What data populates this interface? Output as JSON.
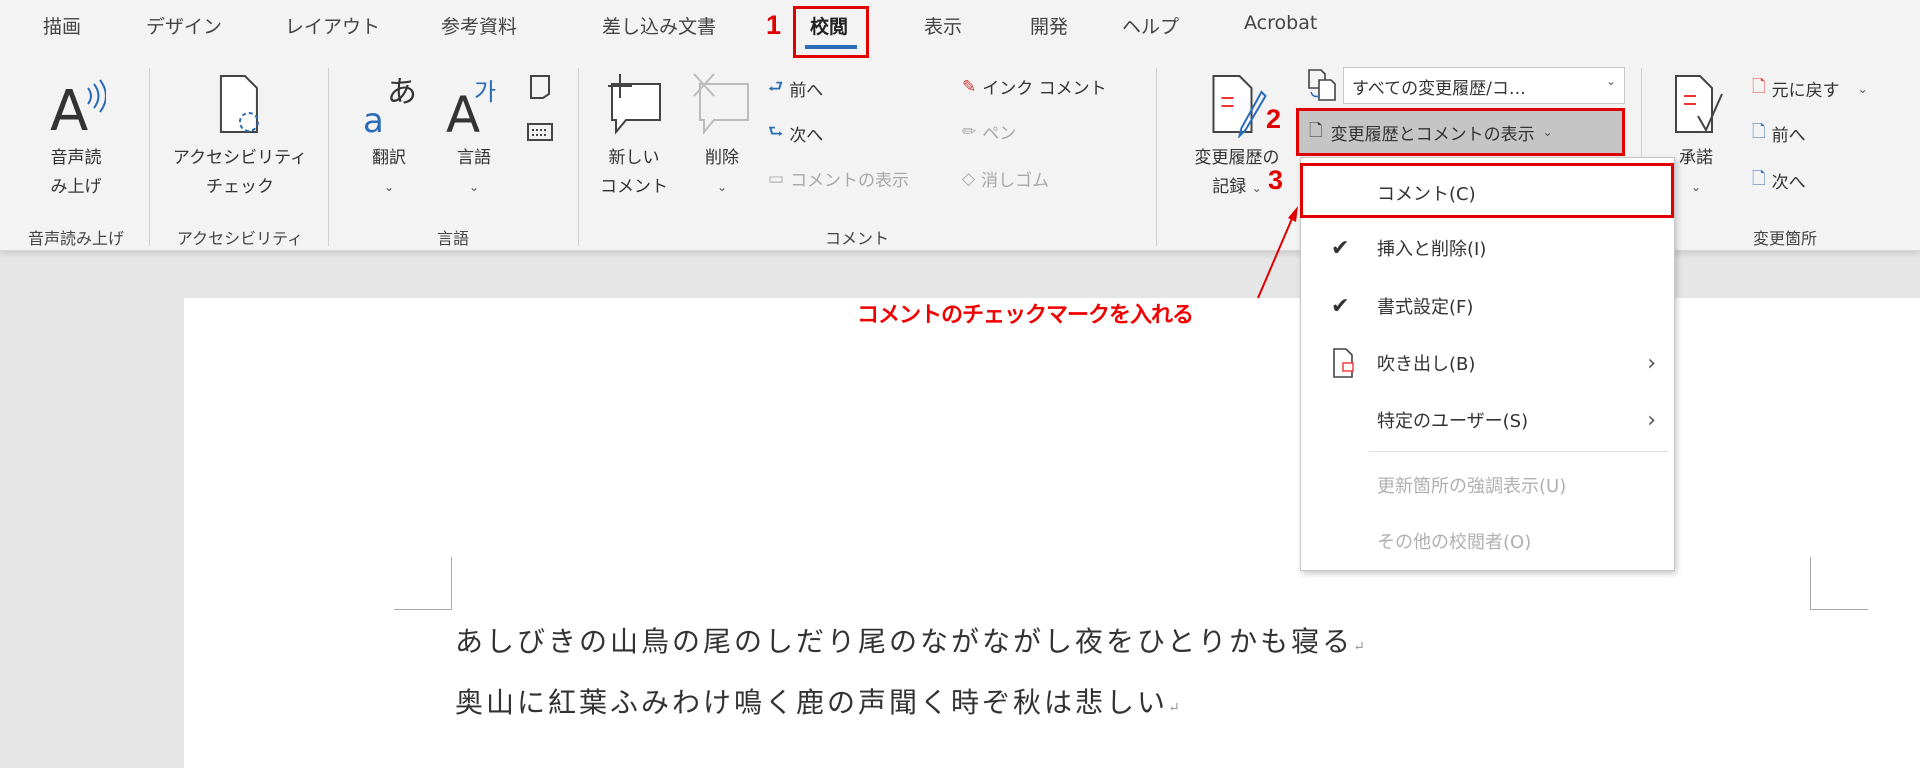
{
  "tabs": [
    "描画",
    "デザイン",
    "レイアウト",
    "参考資料",
    "差し込み文書",
    "校閲",
    "表示",
    "開発",
    "ヘルプ",
    "Acrobat"
  ],
  "active_tab": "校閲",
  "steps": [
    "1",
    "2",
    "3"
  ],
  "ribbon": {
    "speech": {
      "label1": "音声読",
      "label2": "み上げ",
      "group": "音声読み上げ"
    },
    "accessibility": {
      "label1": "アクセシビリティ",
      "label2": "チェック",
      "group": "アクセシビリティ"
    },
    "language": {
      "translate": "翻訳",
      "language": "言語",
      "group": "言語"
    },
    "comments": {
      "new1": "新しい",
      "new2": "コメント",
      "delete": "削除",
      "prev": "前へ",
      "next": "次へ",
      "show": "コメントの表示",
      "ink": "インク コメント",
      "pen": "ペン",
      "eraser": "消しゴム",
      "group": "コメント"
    },
    "tracking": {
      "record1": "変更履歴の",
      "record2": "記録",
      "combo_value": "すべての変更履歴/コ…",
      "show_markup": "変更履歴とコメントの表示"
    },
    "changes": {
      "accept": "承諾",
      "reject": "元に戻す",
      "prev": "前へ",
      "next": "次へ",
      "group": "変更箇所"
    }
  },
  "menu": {
    "items": [
      {
        "label": "コメント(C)",
        "checked": false
      },
      {
        "label": "挿入と削除(I)",
        "checked": true
      },
      {
        "label": "書式設定(F)",
        "checked": true
      },
      {
        "label": "吹き出し(B)",
        "submenu": true
      },
      {
        "label": "特定のユーザー(S)",
        "submenu": true
      },
      {
        "label": "更新箇所の強調表示(U)",
        "disabled": true
      },
      {
        "label": "その他の校閲者(O)",
        "disabled": true
      }
    ]
  },
  "annotation": "コメントのチェックマークを入れる",
  "document": {
    "lines": [
      "あしびきの山鳥の尾のしだり尾のながながし夜をひとりかも寝る",
      "奥山に紅葉ふみわけ鳴く鹿の声聞く時ぞ秋は悲しい"
    ]
  },
  "colors": {
    "accent": "#2b6cb6",
    "highlight": "#e00000"
  }
}
